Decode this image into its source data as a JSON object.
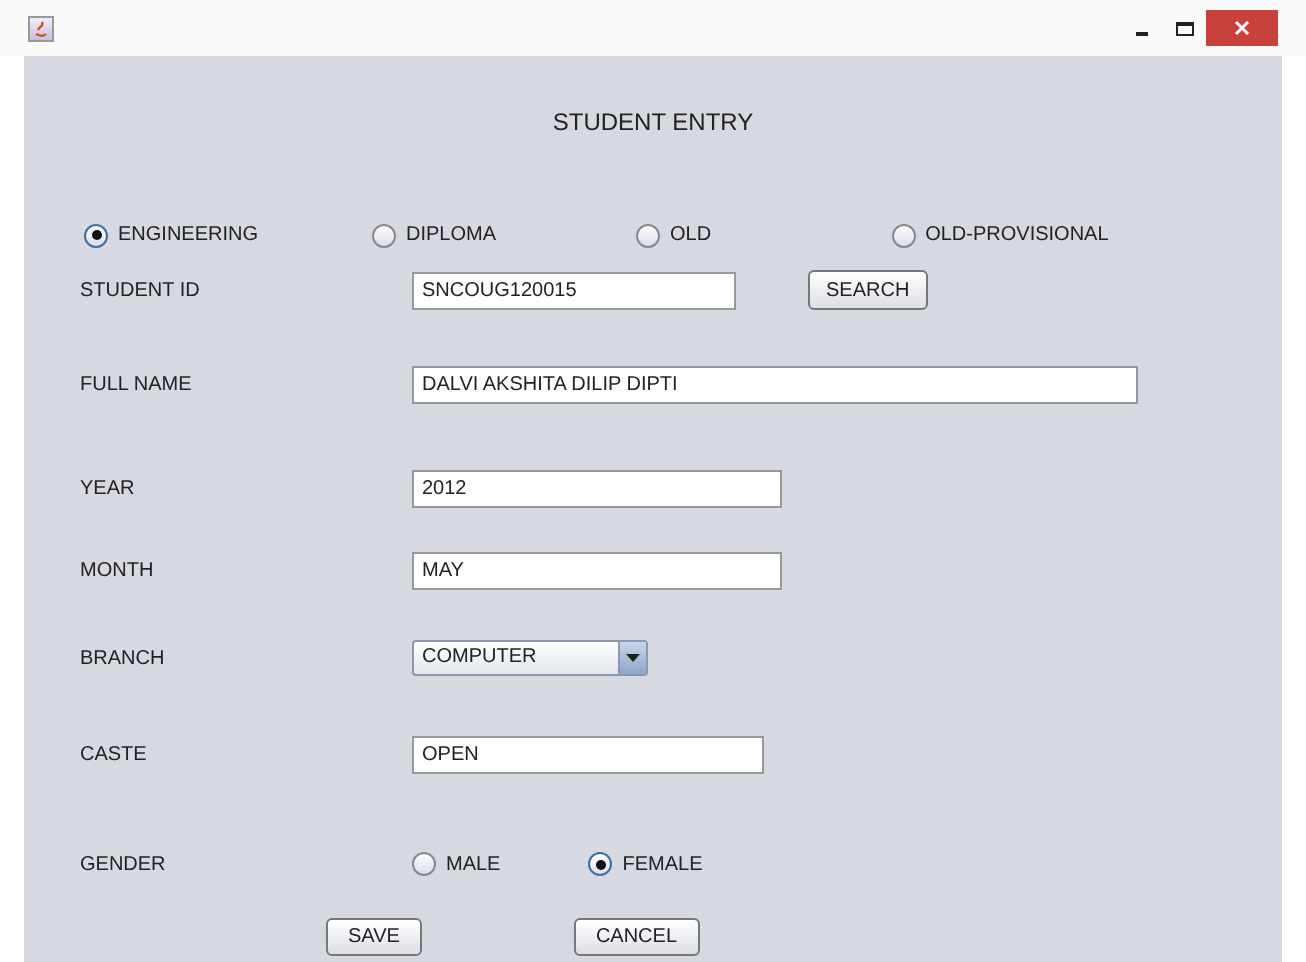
{
  "heading": "STUDENT ENTRY",
  "programs": [
    {
      "label": "ENGINEERING",
      "selected": true
    },
    {
      "label": "DIPLOMA",
      "selected": false
    },
    {
      "label": "OLD",
      "selected": false
    },
    {
      "label": "OLD-PROVISIONAL",
      "selected": false
    }
  ],
  "fields": [
    {
      "kind": "text",
      "label": "STUDENT ID",
      "value": "SNCOUG120015",
      "button": "SEARCH"
    },
    {
      "kind": "text",
      "label": "FULL NAME",
      "value": "DALVI AKSHITA DILIP DIPTI"
    },
    {
      "kind": "text",
      "label": "YEAR",
      "value": "2012"
    },
    {
      "kind": "text",
      "label": "MONTH",
      "value": "MAY"
    },
    {
      "kind": "combo",
      "label": "BRANCH",
      "value": "COMPUTER"
    },
    {
      "kind": "text",
      "label": "CASTE",
      "value": "OPEN"
    },
    {
      "kind": "radio",
      "label": "GENDER",
      "options": [
        {
          "label": "MALE",
          "selected": false
        },
        {
          "label": "FEMALE",
          "selected": true
        }
      ]
    }
  ],
  "buttons": [
    "SAVE",
    "CANCEL"
  ]
}
